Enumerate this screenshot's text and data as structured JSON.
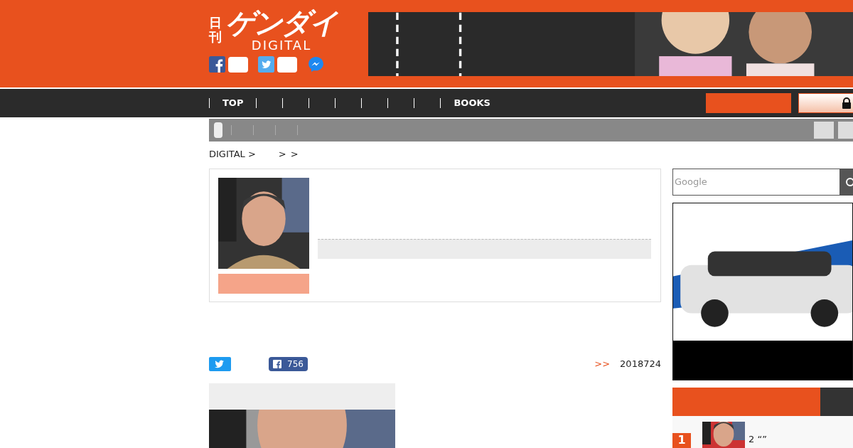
{
  "header": {
    "logo": {
      "small": "日刊",
      "main": "ゲンダイ",
      "sub": "DIGITAL"
    }
  },
  "nav": {
    "items": [
      {
        "label": "TOP"
      },
      {
        "label": "BOOKS"
      }
    ]
  },
  "breadcrumb": [
    "DIGITAL >",
    ">",
    ">"
  ],
  "article": {
    "share": {
      "facebook_count": "756"
    },
    "date_marker": ">>",
    "date": "2018724"
  },
  "sidebar": {
    "search": {
      "placeholder": "Google"
    },
    "ranking": [
      {
        "rank": "1",
        "title": "2 “”"
      }
    ]
  }
}
